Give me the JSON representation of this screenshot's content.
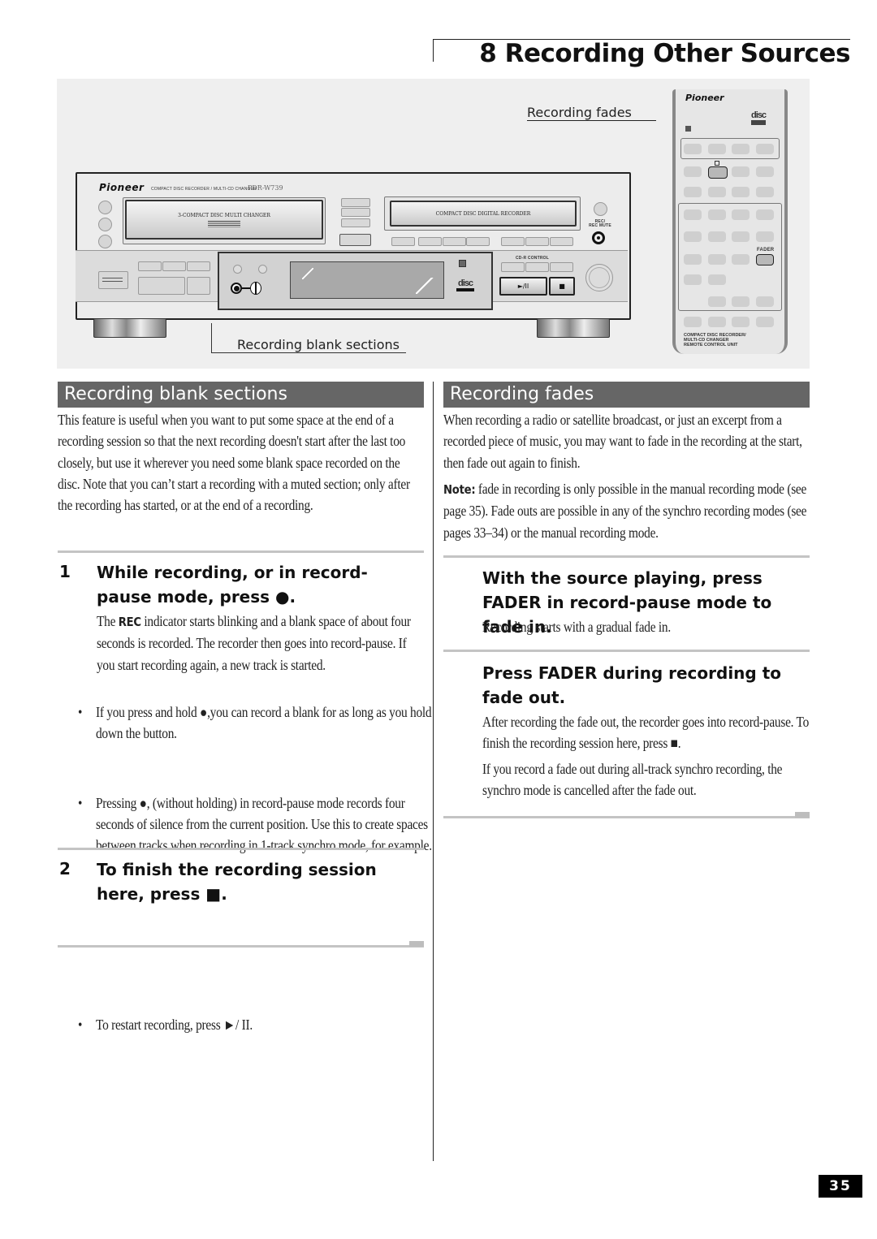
{
  "header": {
    "chapter_title": "8 Recording Other Sources"
  },
  "illustration": {
    "callout_fades": "Recording fades",
    "callout_blank": "Recording blank sections",
    "recorder": {
      "brand": "Pioneer",
      "product_line": "COMPACT DISC RECORDER / MULTI-CD CHANGER",
      "model": "PDR-W739",
      "left_tray_label": "3-COMPACT DISC MULTI CHANGER",
      "right_tray_label": "COMPACT DISC DIGITAL RECORDER",
      "rec_button_label": "REC/\nREC MUTE",
      "rec_symbol": "⊙",
      "cdr_control_label": "CD-R CONTROL",
      "play_pause_label": "►/II",
      "stop_label": "■",
      "disc_logo": "disc"
    },
    "remote": {
      "brand": "Pioneer",
      "disc_logo": "disc",
      "fader_label": "FADER",
      "footer_label": "COMPACT DISC RECORDER/\nMULTI-CD CHANGER\nREMOTE CONTROL UNIT"
    }
  },
  "left_section": {
    "title": "Recording blank sections",
    "intro": "This feature is useful when you want to put some space at the end of a recording session so that the next recording doesn't start after the last too closely, but use it wherever you need some blank space recorded on the disc. Note that you can’t start a recording with a muted section; only after the recording has started, or at the end of a recording.",
    "steps": [
      {
        "number": "1",
        "heading": "While recording, or in record-pause mode, press ●.",
        "body_pre": "The ",
        "body_bold": "REC",
        "body_post": " indicator starts blinking and a blank space of about four seconds is recorded. The recorder then goes into record-pause. If you start recording again, a new track is started.",
        "bullets": [
          "If you press and hold ●,you can record a blank for as long as you hold down the button.",
          "Pressing ●, (without holding) in record-pause mode records four seconds of silence from the current position. Use this to create spaces between tracks when recording in 1-track synchro mode, for example."
        ]
      },
      {
        "number": "2",
        "heading": "To finish the recording session here, press ■.",
        "bullets": [
          "To restart recording, press ►/ II."
        ]
      }
    ]
  },
  "right_section": {
    "title": "Recording fades",
    "intro": "When recording a radio or satellite broadcast, or just an excerpt from a recorded piece of music, you may want to fade in the recording at the start, then fade out again to finish.",
    "note_label": "Note:",
    "note_text": " fade in recording is only possible in the manual recording mode (see page 35). Fade outs are possible in any of the synchro recording modes (see pages 33–34) or the manual recording mode.",
    "steps": [
      {
        "heading": "With the source playing, press FADER in record-pause mode to fade in.",
        "paragraphs": [
          "Recording starts with a gradual fade in."
        ]
      },
      {
        "heading": "Press FADER during recording to fade out.",
        "paragraphs": [
          "After recording the fade out, the recorder goes into record-pause. To finish the recording session here, press ■.",
          "If you record a fade out during all-track synchro recording, the synchro mode is cancelled after the fade out."
        ]
      }
    ]
  },
  "footer": {
    "page_number": "35"
  }
}
